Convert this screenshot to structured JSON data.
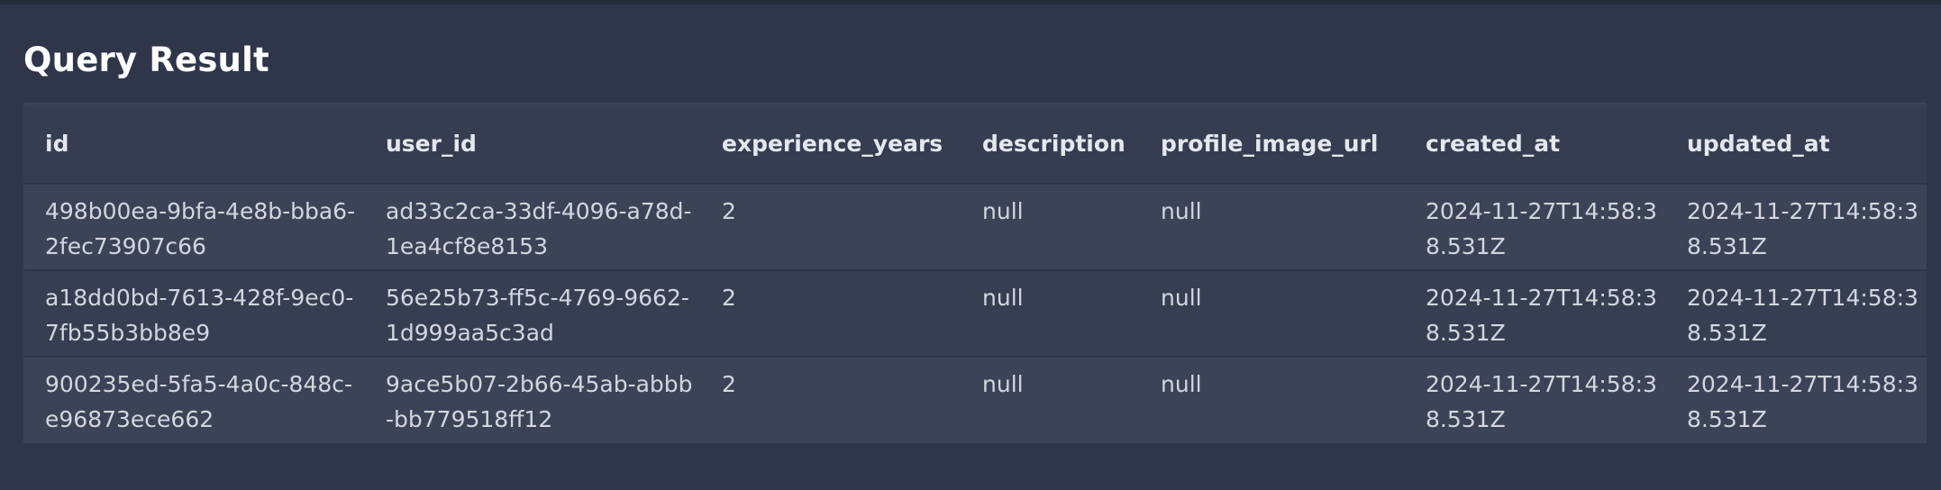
{
  "panel": {
    "title": "Query Result"
  },
  "table": {
    "columns": [
      "id",
      "user_id",
      "experience_years",
      "description",
      "profile_image_url",
      "created_at",
      "updated_at"
    ],
    "rows": [
      [
        "498b00ea-9bfa-4e8b-bba6-2fec73907c66",
        "ad33c2ca-33df-4096-a78d-1ea4cf8e8153",
        "2",
        "null",
        "null",
        "2024-11-27T14:58:38.531Z",
        "2024-11-27T14:58:38.531Z"
      ],
      [
        "a18dd0bd-7613-428f-9ec0-7fb55b3bb8e9",
        "56e25b73-ff5c-4769-9662-1d999aa5c3ad",
        "2",
        "null",
        "null",
        "2024-11-27T14:58:38.531Z",
        "2024-11-27T14:58:38.531Z"
      ],
      [
        "900235ed-5fa5-4a0c-848c-e96873ece662",
        "9ace5b07-2b66-45ab-abbb-bb779518ff12",
        "2",
        "null",
        "null",
        "2024-11-27T14:58:38.531Z",
        "2024-11-27T14:58:38.531Z"
      ]
    ]
  }
}
